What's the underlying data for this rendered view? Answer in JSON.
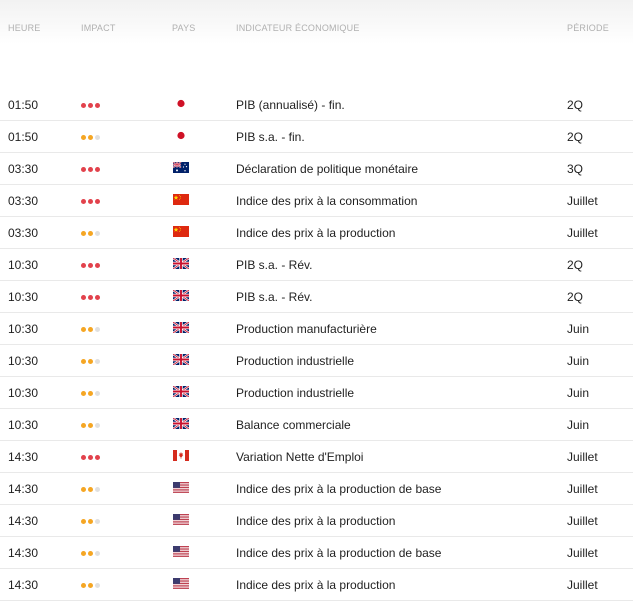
{
  "header": {
    "time": "HEURE",
    "impact": "IMPACT",
    "country": "PAYS",
    "indicator": "INDICATEUR ÉCONOMIQUE",
    "period": "PÉRIODE"
  },
  "impact_colors": {
    "high": "#e2424c",
    "medium": "#f5a623",
    "inactive": "#e0e0e0"
  },
  "rows": [
    {
      "time": "01:50",
      "impact": "high",
      "country": "japan-flag",
      "indicator": "PIB (annualisé) - fin.",
      "period": "2Q"
    },
    {
      "time": "01:50",
      "impact": "medium",
      "country": "japan-flag",
      "indicator": "PIB s.a. - fin.",
      "period": "2Q"
    },
    {
      "time": "03:30",
      "impact": "high",
      "country": "australia-flag",
      "indicator": "Déclaration de politique monétaire",
      "period": "3Q"
    },
    {
      "time": "03:30",
      "impact": "high",
      "country": "china-flag",
      "indicator": "Indice des prix à la consommation",
      "period": "Juillet"
    },
    {
      "time": "03:30",
      "impact": "medium",
      "country": "china-flag",
      "indicator": "Indice des prix à la production",
      "period": "Juillet"
    },
    {
      "time": "10:30",
      "impact": "high",
      "country": "uk-flag",
      "indicator": "PIB s.a. - Rév.",
      "period": "2Q"
    },
    {
      "time": "10:30",
      "impact": "high",
      "country": "uk-flag",
      "indicator": "PIB s.a. - Rév.",
      "period": "2Q"
    },
    {
      "time": "10:30",
      "impact": "medium",
      "country": "uk-flag",
      "indicator": "Production manufacturière",
      "period": "Juin"
    },
    {
      "time": "10:30",
      "impact": "medium",
      "country": "uk-flag",
      "indicator": "Production industrielle",
      "period": "Juin"
    },
    {
      "time": "10:30",
      "impact": "medium",
      "country": "uk-flag",
      "indicator": "Production industrielle",
      "period": "Juin"
    },
    {
      "time": "10:30",
      "impact": "medium",
      "country": "uk-flag",
      "indicator": "Balance commerciale",
      "period": "Juin"
    },
    {
      "time": "14:30",
      "impact": "high",
      "country": "canada-flag",
      "indicator": "Variation Nette d'Emploi",
      "period": "Juillet"
    },
    {
      "time": "14:30",
      "impact": "medium",
      "country": "usa-flag",
      "indicator": "Indice des prix à la production de base",
      "period": "Juillet"
    },
    {
      "time": "14:30",
      "impact": "medium",
      "country": "usa-flag",
      "indicator": "Indice des prix à la production",
      "period": "Juillet"
    },
    {
      "time": "14:30",
      "impact": "medium",
      "country": "usa-flag",
      "indicator": "Indice des prix à la production de base",
      "period": "Juillet"
    },
    {
      "time": "14:30",
      "impact": "medium",
      "country": "usa-flag",
      "indicator": "Indice des prix à la production",
      "period": "Juillet"
    }
  ]
}
